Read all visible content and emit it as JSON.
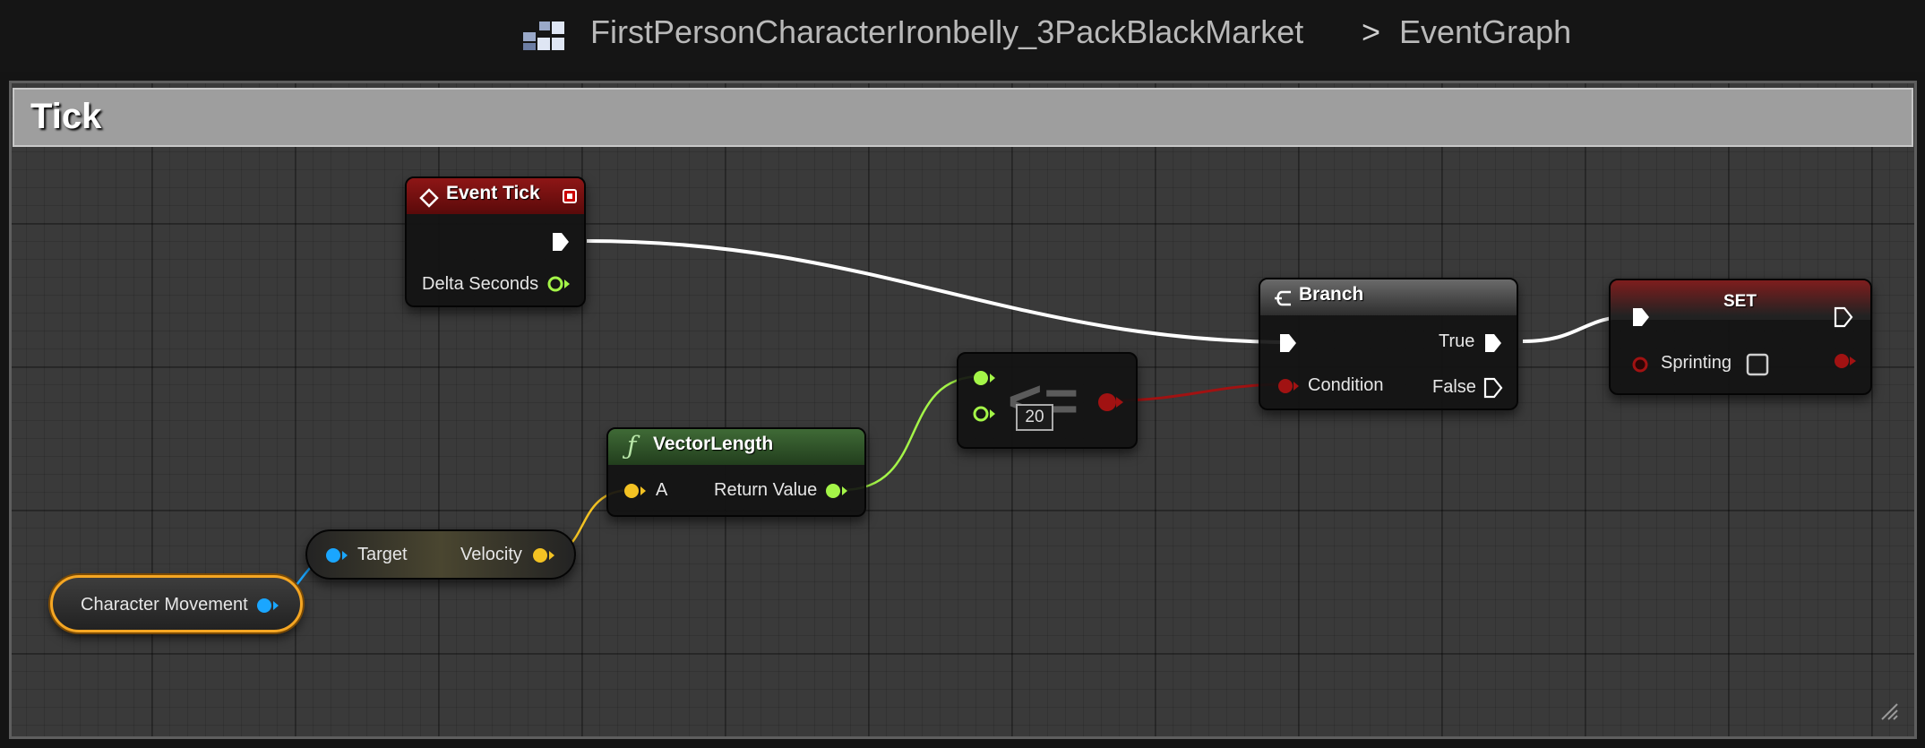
{
  "breadcrumb": {
    "asset_name": "FirstPersonCharacterIronbelly_3PackBlackMarket",
    "separator": ">",
    "graph_name": "EventGraph"
  },
  "comment": {
    "title": "Tick"
  },
  "nodes": {
    "event_tick": {
      "title": "Event Tick",
      "delta_seconds": "Delta Seconds"
    },
    "branch": {
      "title": "Branch",
      "condition": "Condition",
      "true_label": "True",
      "false_label": "False"
    },
    "set": {
      "title": "SET",
      "variable": "Sprinting"
    },
    "vector_length": {
      "title": "VectorLength",
      "input_a": "A",
      "return_value": "Return Value"
    },
    "compare": {
      "operator": "<=",
      "literal_value": "20"
    },
    "get_velocity": {
      "target": "Target",
      "velocity": "Velocity"
    },
    "character_movement": {
      "label": "Character Movement"
    }
  },
  "colors": {
    "event_header": "#8a1010",
    "function_header": "#355d2c",
    "set_header": "#7a1a1a",
    "exec_wire": "#ffffff",
    "float_pin": "#a4f548",
    "bool_pin": "#a11212",
    "vector_pin": "#f3c223",
    "object_pin": "#1aa6ff",
    "selection_outline": "#f5a623"
  },
  "icons": [
    "blueprint-icon",
    "event-diamond-icon",
    "delegate-square-icon",
    "branch-icon",
    "function-icon",
    "checkbox-icon",
    "resize-grip-icon"
  ]
}
